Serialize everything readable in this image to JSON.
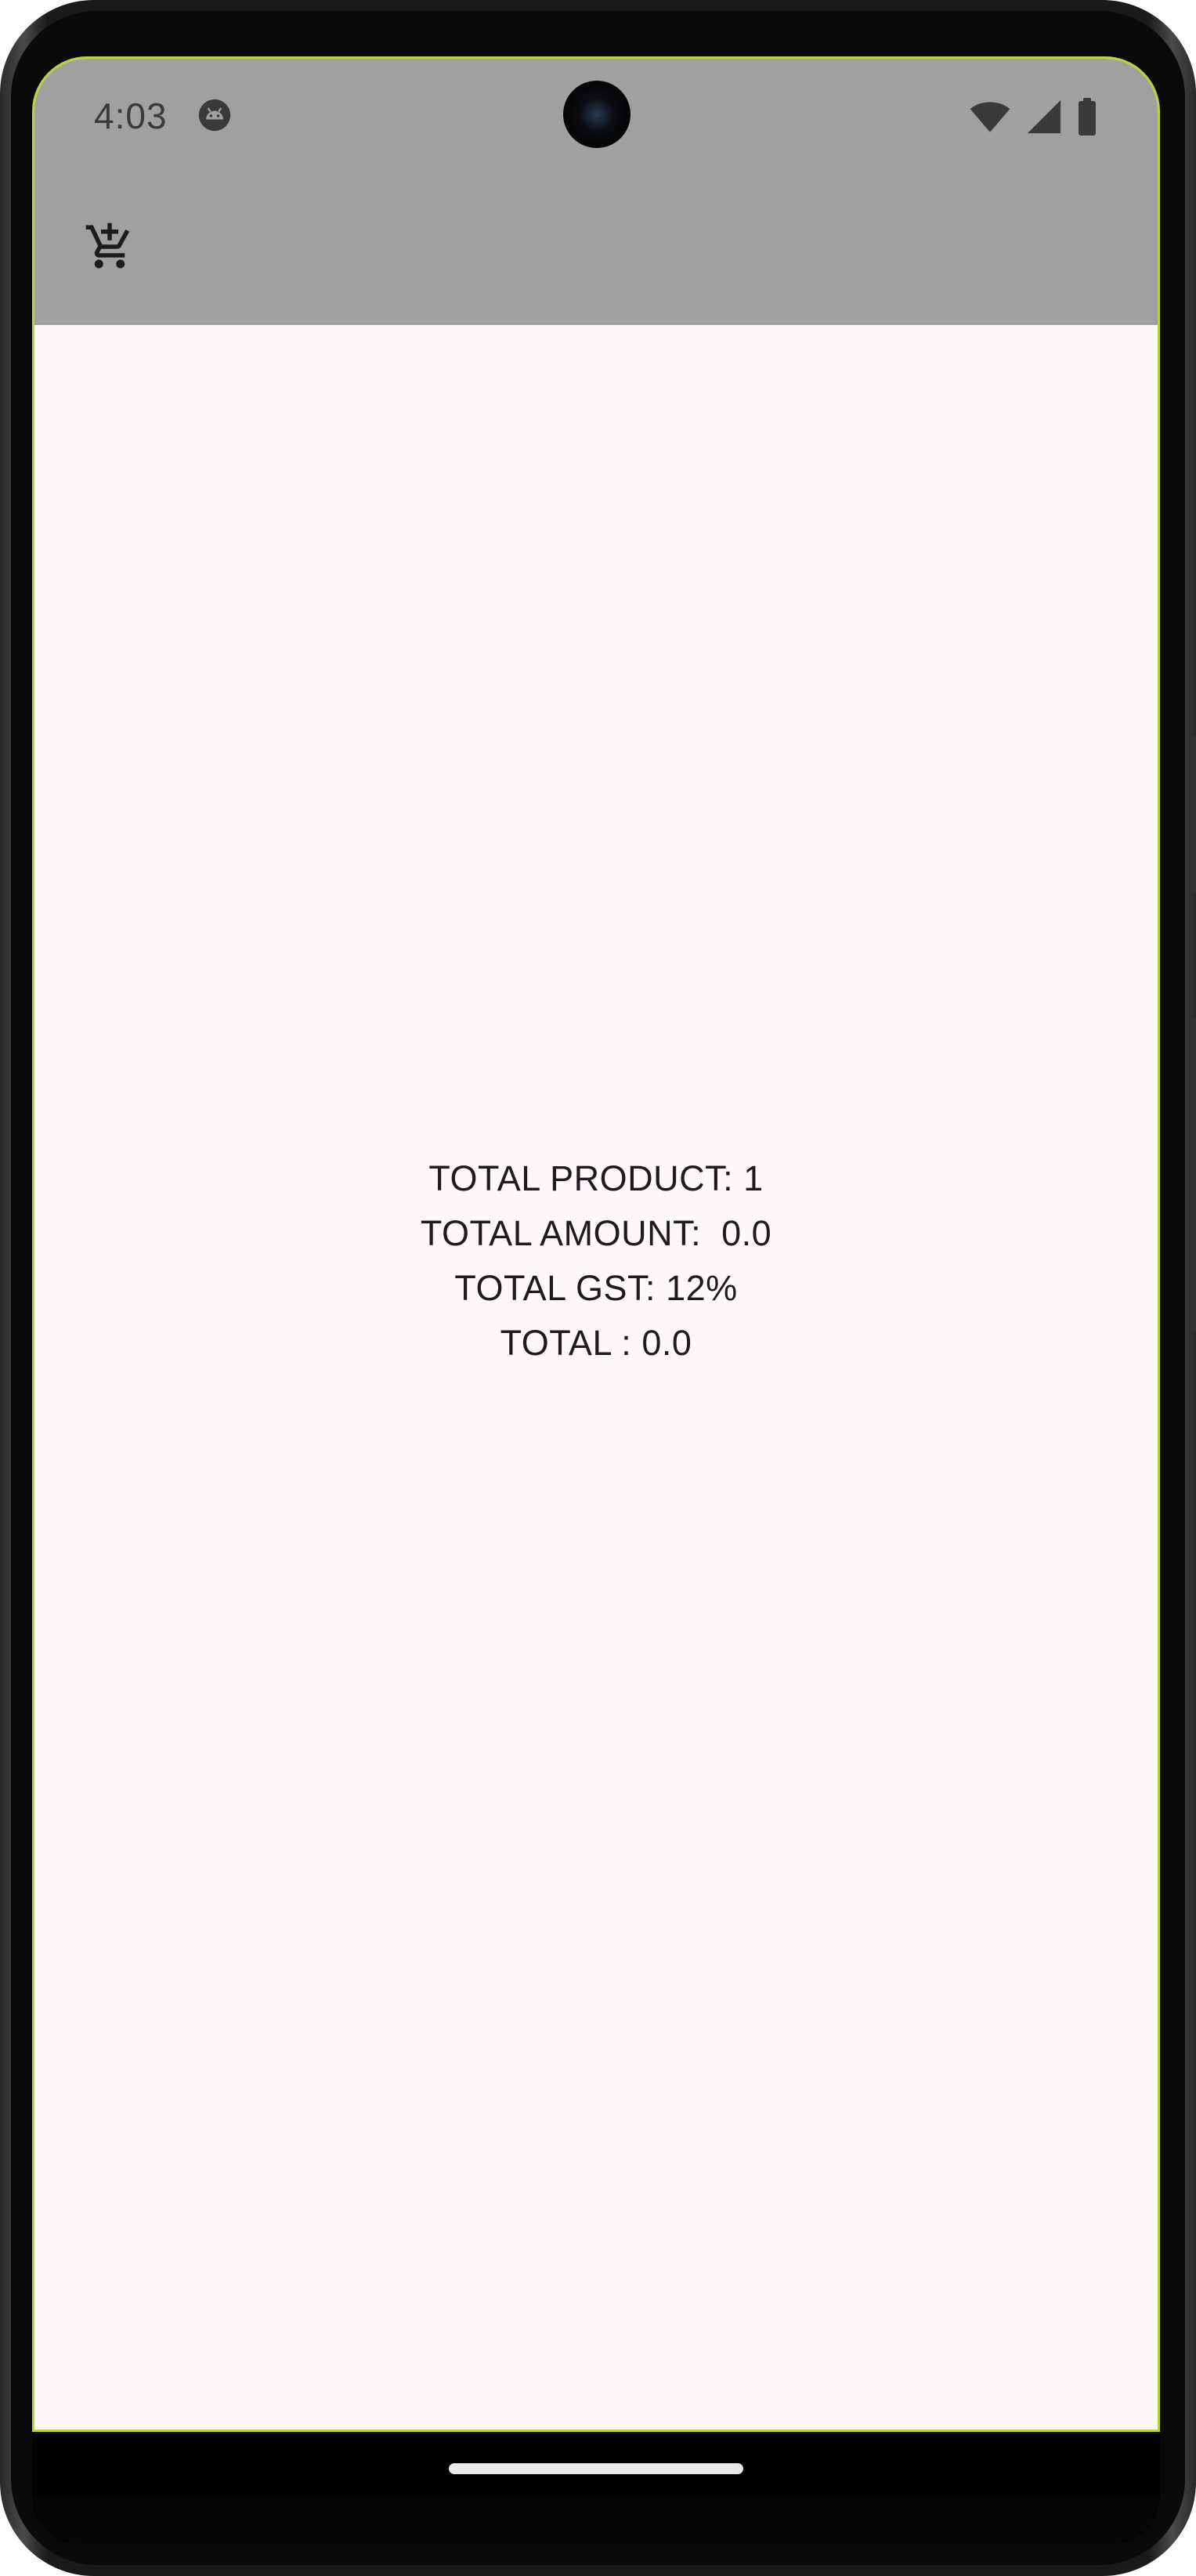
{
  "status_bar": {
    "time": "4:03",
    "icons": [
      "android-app-icon",
      "wifi-icon",
      "cellular-signal-icon",
      "battery-icon"
    ]
  },
  "app_bar": {
    "background_color": "#a0a0a0",
    "action_icon": "add-shopping-cart-icon"
  },
  "summary": {
    "total_product": "TOTAL PRODUCT: 1",
    "total_amount": "TOTAL AMOUNT:  0.0",
    "total_gst": "TOTAL GST: 12%",
    "total": "TOTAL : 0.0"
  },
  "colors": {
    "screen_background": "#fdf9fb",
    "screen_border": "#b5d53b",
    "text": "#1c1b1f"
  }
}
